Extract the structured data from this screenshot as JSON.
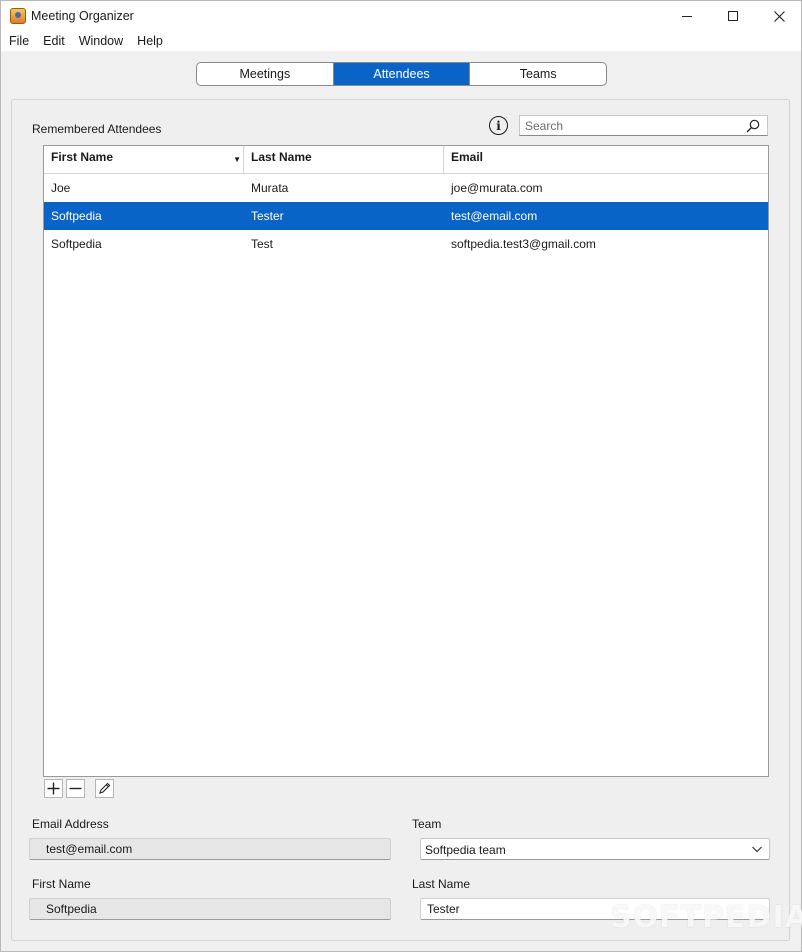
{
  "window": {
    "title": "Meeting Organizer"
  },
  "menu": [
    "File",
    "Edit",
    "Window",
    "Help"
  ],
  "tabs": [
    {
      "label": "Meetings",
      "active": false
    },
    {
      "label": "Attendees",
      "active": true
    },
    {
      "label": "Teams",
      "active": false
    }
  ],
  "attendees": {
    "section_label": "Remembered Attendees",
    "search_placeholder": "Search",
    "columns": [
      "First Name",
      "Last Name",
      "Email"
    ],
    "sort_indicator": "▼",
    "rows": [
      {
        "first": "Joe",
        "last": "Murata",
        "email": "joe@murata.com",
        "selected": false
      },
      {
        "first": "Softpedia",
        "last": "Tester",
        "email": "test@email.com",
        "selected": true
      },
      {
        "first": "Softpedia",
        "last": "Test",
        "email": "softpedia.test3@gmail.com",
        "selected": false
      }
    ]
  },
  "details": {
    "email_label": "Email Address",
    "email_value": "test@email.com",
    "team_label": "Team",
    "team_value": "Softpedia team",
    "first_label": "First Name",
    "first_value": "Softpedia",
    "last_label": "Last Name",
    "last_value": "Tester"
  },
  "watermark": "SOFTPEDIA",
  "colors": {
    "accent": "#0a64c8",
    "selection": "#0a64c8"
  }
}
